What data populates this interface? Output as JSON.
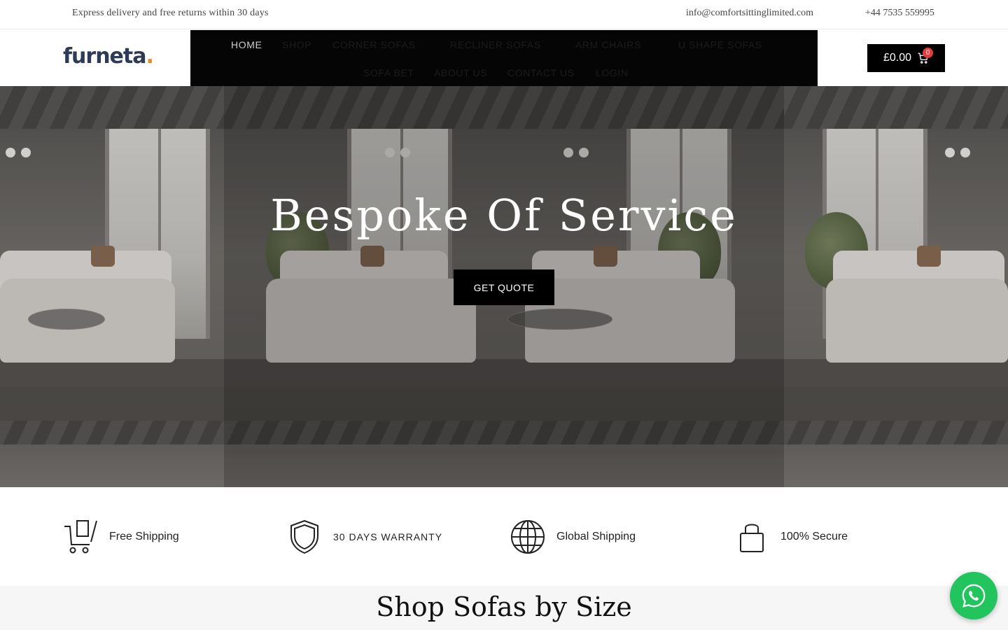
{
  "topbar": {
    "promo": "Express delivery and free returns within 30 days",
    "email": "info@comfortsittinglimited.com",
    "phone": "+44 7535 559995"
  },
  "header": {
    "logo": "furneta",
    "logo_dot": ".",
    "nav": [
      {
        "label": "HOME"
      },
      {
        "label": "SHOP"
      },
      {
        "label": "CORNER SOFAS"
      },
      {
        "label": "RECLINER SOFAS"
      },
      {
        "label": "ARM CHAIRS"
      },
      {
        "label": "U SHAPE SOFAS"
      },
      {
        "label": "SOFA BET"
      },
      {
        "label": "ABOUT US"
      },
      {
        "label": "CONTACT US"
      },
      {
        "label": "LOGIN"
      }
    ],
    "cart_total": "£0.00",
    "cart_count": "0"
  },
  "hero": {
    "title": "Bespoke Of Service",
    "button": "GET QUOTE"
  },
  "features": [
    {
      "label": "Free Shipping",
      "icon": "cart-icon"
    },
    {
      "label": "30 DAYS WARRANTY",
      "icon": "shield-icon"
    },
    {
      "label": "Global Shipping",
      "icon": "globe-icon"
    },
    {
      "label": "100% Secure",
      "icon": "lock-icon"
    }
  ],
  "shop_by_size": {
    "title": "Shop Sofas by Size"
  },
  "colors": {
    "accent": "#e8872a",
    "logo": "#2e3b57",
    "whatsapp": "#21c45d",
    "badge": "#e23c3c"
  }
}
